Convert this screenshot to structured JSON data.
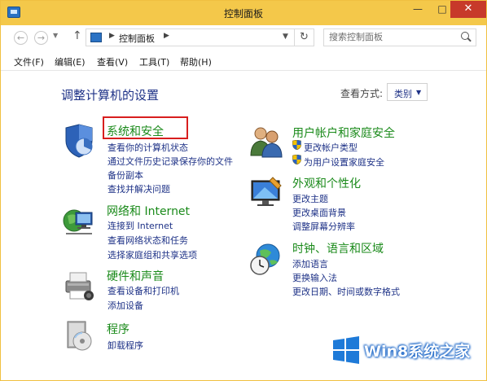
{
  "window": {
    "title": "控制面板",
    "minimize": "—",
    "maximize": "□",
    "close": "✕"
  },
  "address": {
    "path_label": "控制面板",
    "search_placeholder": "搜索控制面板"
  },
  "menu": [
    {
      "label": "文件(F)"
    },
    {
      "label": "编辑(E)"
    },
    {
      "label": "查看(V)"
    },
    {
      "label": "工具(T)"
    },
    {
      "label": "帮助(H)"
    }
  ],
  "content": {
    "heading": "调整计算机的设置",
    "view_by_label": "查看方式:",
    "view_by_value": "类别"
  },
  "categories": {
    "system": {
      "title": "系统和安全",
      "links": [
        "查看你的计算机状态",
        "通过文件历史记录保存你的文件",
        "备份副本",
        "查找并解决问题"
      ]
    },
    "network": {
      "title": "网络和 Internet",
      "links": [
        "连接到 Internet",
        "查看网络状态和任务",
        "选择家庭组和共享选项"
      ]
    },
    "hardware": {
      "title": "硬件和声音",
      "links": [
        "查看设备和打印机",
        "添加设备"
      ]
    },
    "programs": {
      "title": "程序",
      "links": [
        "卸载程序"
      ]
    },
    "users": {
      "title": "用户帐户和家庭安全",
      "links": [
        "更改帐户类型",
        "为用户设置家庭安全"
      ]
    },
    "appearance": {
      "title": "外观和个性化",
      "links": [
        "更改主题",
        "更改桌面背景",
        "调整屏幕分辨率"
      ]
    },
    "clock": {
      "title": "时钟、语言和区域",
      "links": [
        "添加语言",
        "更换输入法",
        "更改日期、时间或数字格式"
      ]
    }
  },
  "watermark": {
    "text": "Win8系统之家"
  },
  "colors": {
    "titlebar": "#f4c84a",
    "link_blue": "#1e3287",
    "category_green": "#1a8a1a",
    "highlight_red": "#d81e1e"
  }
}
